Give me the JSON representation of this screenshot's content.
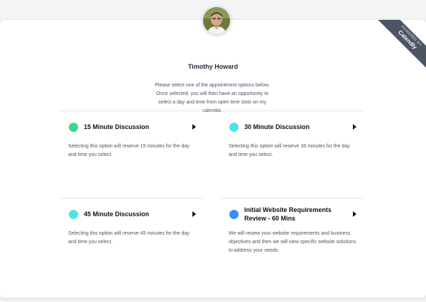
{
  "profile": {
    "name": "Timothy Howard",
    "intro": "Please select one of the appointment options below. Once selected, you will then have an opportunity to select a day and time from open time slots on my calendar."
  },
  "badge": {
    "powered_by": "POWERED BY",
    "brand": "Calendly"
  },
  "options": [
    {
      "title": "15 Minute Discussion",
      "description": "Selecting this option will reserve 15 minutes for the day and time you select.",
      "color": "#3dd68c"
    },
    {
      "title": "30 Minute Discussion",
      "description": "Selecting this option will reserve 30 minutes for the day and time you select.",
      "color": "#4ee3e8"
    },
    {
      "title": "45 Minute Discussion",
      "description": "Selecting this option will reserve 45 minutes for the day and time you select.",
      "color": "#4ee3e8"
    },
    {
      "title": "Initial Website Requirements Review - 60 Mins",
      "description": "We will review your website requirements and business objectives and then we will view specific website solutions to address your needs.",
      "color": "#3b8fea"
    }
  ]
}
